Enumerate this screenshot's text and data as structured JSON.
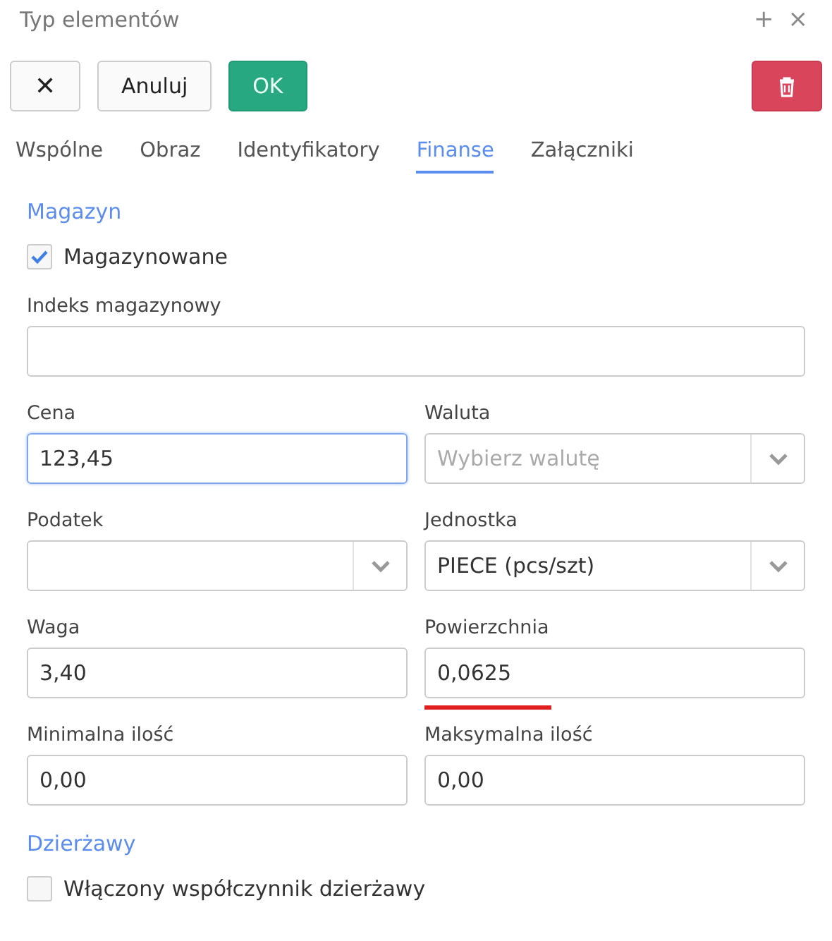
{
  "window": {
    "title": "Typ elementów",
    "actions": [
      "+",
      "×"
    ]
  },
  "toolbar": {
    "close": "✕",
    "cancel": "Anuluj",
    "ok": "OK"
  },
  "tabs": [
    {
      "label": "Wspólne",
      "selected": false
    },
    {
      "label": "Obraz",
      "selected": false
    },
    {
      "label": "Identyfikatory",
      "selected": false
    },
    {
      "label": "Finanse",
      "selected": true
    },
    {
      "label": "Załączniki",
      "selected": false
    }
  ],
  "sections": [
    {
      "title": "Magazyn",
      "checkbox": {
        "label": "Magazynowane",
        "checked": true
      },
      "rows": [
        [
          {
            "label": "Indeks magazynowy",
            "kind": "input",
            "focused": false
          }
        ],
        [
          {
            "label": "Cena",
            "kind": "input",
            "value": "123,45",
            "focused": true
          },
          {
            "label": "Waluta",
            "kind": "select",
            "placeholder": "Wybierz walutę",
            "focused": false
          }
        ],
        [
          {
            "label": "Podatek",
            "kind": "select",
            "focused": false
          },
          {
            "label": "Jednostka",
            "kind": "select",
            "value": "PIECE (pcs/szt)",
            "focused": false
          }
        ],
        [
          {
            "label": "Waga",
            "kind": "input",
            "value": "3,40",
            "focused": false
          },
          {
            "label": "Powierzchnia",
            "kind": "input",
            "value": "0,0625",
            "focused": false,
            "marked": true
          }
        ],
        [
          {
            "label": "Minimalna ilość",
            "kind": "input",
            "value": "0,00",
            "focused": false
          },
          {
            "label": "Maksymalna ilość",
            "kind": "input",
            "value": "0,00",
            "focused": false
          }
        ]
      ]
    },
    {
      "title": "Dzierżawy",
      "checkbox": {
        "label": "Włączony współczynnik dzierżawy",
        "checked": false
      }
    }
  ]
}
